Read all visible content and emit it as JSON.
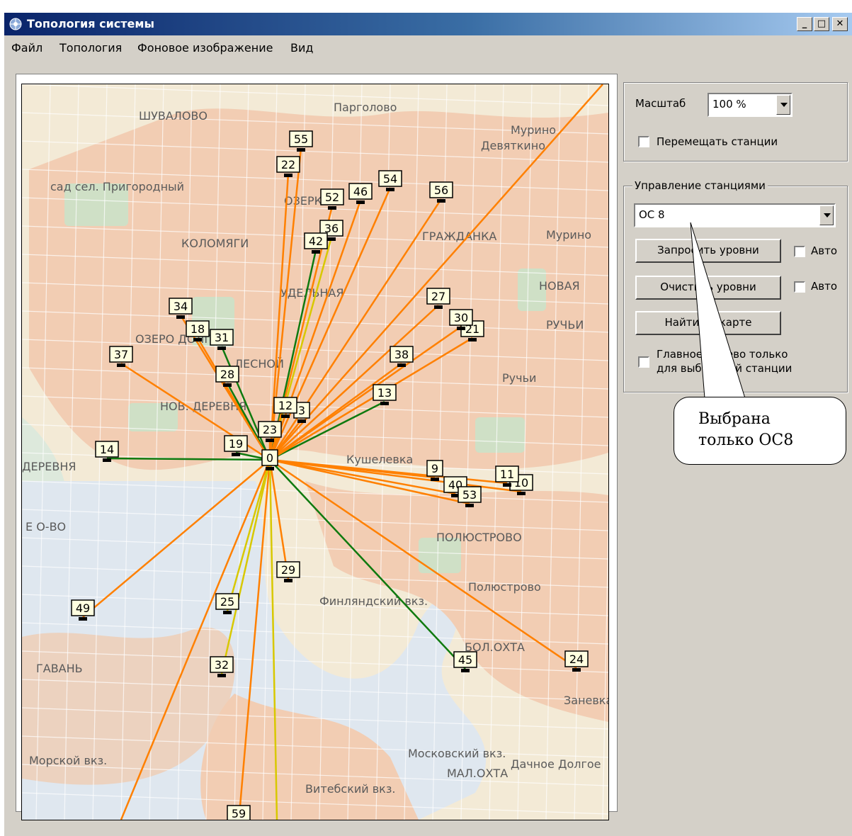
{
  "window": {
    "title": "Топология системы",
    "controls": [
      "_",
      "□",
      "✕"
    ]
  },
  "menu": [
    "Файл",
    "Топология",
    "Фоновое изображение",
    "Вид"
  ],
  "map": {
    "labels": [
      {
        "t": "ШУВАЛОВО"
      },
      {
        "t": "Мурино"
      },
      {
        "t": "Девяткино"
      },
      {
        "t": "Парголово"
      },
      {
        "t": "КОЛОМЯГИ"
      },
      {
        "t": "ОЗЕРКИ"
      },
      {
        "t": "ГРАЖДАНКА"
      },
      {
        "t": "Мурино"
      },
      {
        "t": "УДЕЛЬНАЯ"
      },
      {
        "t": "НОВАЯ"
      },
      {
        "t": "РУЧЬИ"
      },
      {
        "t": "ОЗЕРО ДОЛГОЕ"
      },
      {
        "t": "ЛЕСНОЙ"
      },
      {
        "t": "НОВ. ДЕРЕВНЯ"
      },
      {
        "t": "ДЕРЕВНЯ"
      },
      {
        "t": "Кушелевка"
      },
      {
        "t": "ПОЛЮСТРОВО"
      },
      {
        "t": "Полюстрово"
      },
      {
        "t": "Финляндский вкз."
      },
      {
        "t": "БОЛ.ОХТА"
      },
      {
        "t": "Московский вкз."
      },
      {
        "t": "МАЛ.ОХТА"
      },
      {
        "t": "Витебский вкз."
      },
      {
        "t": "Дачное Долгое"
      },
      {
        "t": "Морской вкз."
      },
      {
        "t": "ГАВАНЬ"
      },
      {
        "t": "Е О-ВО"
      },
      {
        "t": "Заневка"
      },
      {
        "t": "Ручьи"
      },
      {
        "t": "сад сел. Пригородный"
      }
    ],
    "stations": [
      {
        "id": "0"
      },
      {
        "id": "3"
      },
      {
        "id": "9"
      },
      {
        "id": "10"
      },
      {
        "id": "11"
      },
      {
        "id": "12"
      },
      {
        "id": "13"
      },
      {
        "id": "14"
      },
      {
        "id": "18"
      },
      {
        "id": "19"
      },
      {
        "id": "21"
      },
      {
        "id": "22"
      },
      {
        "id": "23"
      },
      {
        "id": "24"
      },
      {
        "id": "25"
      },
      {
        "id": "27"
      },
      {
        "id": "28"
      },
      {
        "id": "29"
      },
      {
        "id": "30"
      },
      {
        "id": "31"
      },
      {
        "id": "32"
      },
      {
        "id": "34"
      },
      {
        "id": "36"
      },
      {
        "id": "37"
      },
      {
        "id": "38"
      },
      {
        "id": "40"
      },
      {
        "id": "42"
      },
      {
        "id": "45"
      },
      {
        "id": "46"
      },
      {
        "id": "49"
      },
      {
        "id": "52"
      },
      {
        "id": "53"
      },
      {
        "id": "54"
      },
      {
        "id": "55"
      },
      {
        "id": "56"
      },
      {
        "id": "59"
      }
    ],
    "colors": {
      "orange": "#ff8000",
      "green": "#0f7a0f",
      "yellow": "#d8c800"
    }
  },
  "panel": {
    "scale_label": "Масштаб",
    "scale_value": "100 %",
    "move_stations_label": "Перемещать станции",
    "group_title": "Управление станциями",
    "station_select": "ОС 8",
    "btn_request": "Запросить уровни",
    "btn_clear": "Очистить уровни",
    "btn_find": "Найти на карте",
    "auto1": "Авто",
    "auto2": "Авто",
    "main_tree_line1": "Главное дерево только",
    "main_tree_line2": "для выбранной станции"
  },
  "callout": {
    "line1": "Выбрана",
    "line2": "только ОС8"
  }
}
